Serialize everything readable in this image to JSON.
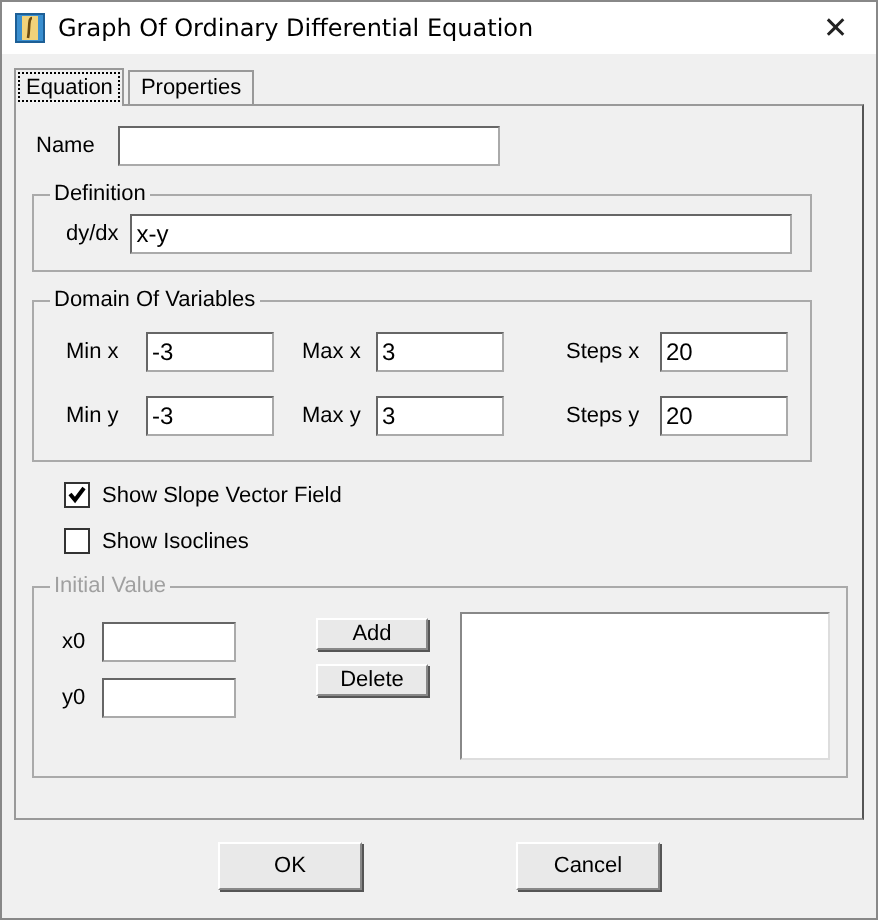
{
  "window": {
    "title": "Graph Of Ordinary Differential Equation",
    "close": "✕"
  },
  "tabs": [
    {
      "label": "Equation",
      "selected": true
    },
    {
      "label": "Properties",
      "selected": false
    }
  ],
  "name": {
    "label": "Name"
  },
  "definition": {
    "title": "Definition",
    "label": "dy/dx",
    "value": "x-y"
  },
  "domain": {
    "title": "Domain Of Variables",
    "fields": [
      {
        "label": "Min x",
        "value": "-3"
      },
      {
        "label": "Max x",
        "value": "3"
      },
      {
        "label": "Steps x",
        "value": "20"
      },
      {
        "label": "Min y",
        "value": "-3"
      },
      {
        "label": "Max y",
        "value": "3"
      },
      {
        "label": "Steps y",
        "value": "20"
      }
    ]
  },
  "options": [
    {
      "label": "Show Slope Vector Field",
      "checked": true
    },
    {
      "label": "Show Isoclines",
      "checked": false
    }
  ],
  "initial_value": {
    "title": "Initial Value",
    "disabled": true,
    "fields": [
      {
        "label": "x0"
      },
      {
        "label": "y0"
      }
    ],
    "buttons": [
      "Add",
      "Delete"
    ]
  },
  "buttons": [
    "OK",
    "Cancel"
  ]
}
